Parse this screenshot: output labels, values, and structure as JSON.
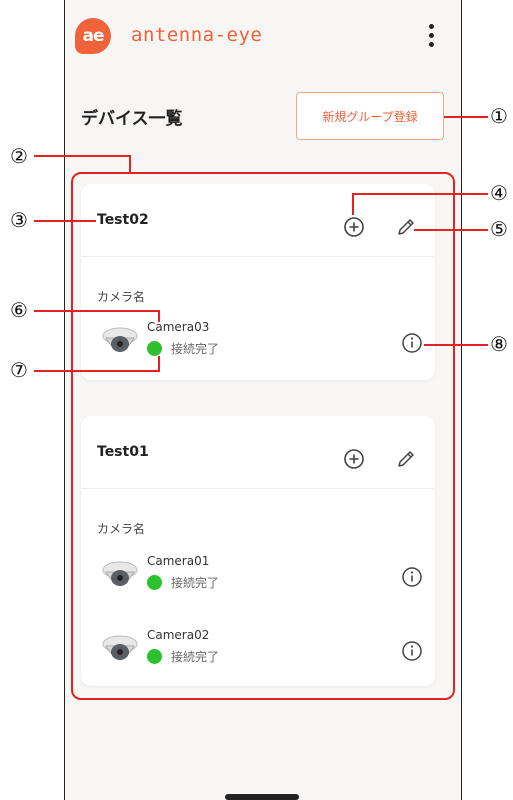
{
  "app": {
    "logo_mark": "ae",
    "logo_text": "antenna-eye",
    "menu_icon": "more-vert-icon"
  },
  "page": {
    "title": "デバイス一覧",
    "new_group_label": "新規グループ登録"
  },
  "groups": [
    {
      "name": "Test02",
      "section_label": "カメラ名",
      "cameras": [
        {
          "name": "Camera03",
          "status": "接続完了"
        }
      ]
    },
    {
      "name": "Test01",
      "section_label": "カメラ名",
      "cameras": [
        {
          "name": "Camera01",
          "status": "接続完了"
        },
        {
          "name": "Camera02",
          "status": "接続完了"
        }
      ]
    }
  ],
  "callouts": [
    "①",
    "②",
    "③",
    "④",
    "⑤",
    "⑥",
    "⑦",
    "⑧"
  ],
  "colors": {
    "brand": "#f0623a",
    "annotation": "#e52222",
    "status_ok": "#2ec12e"
  }
}
